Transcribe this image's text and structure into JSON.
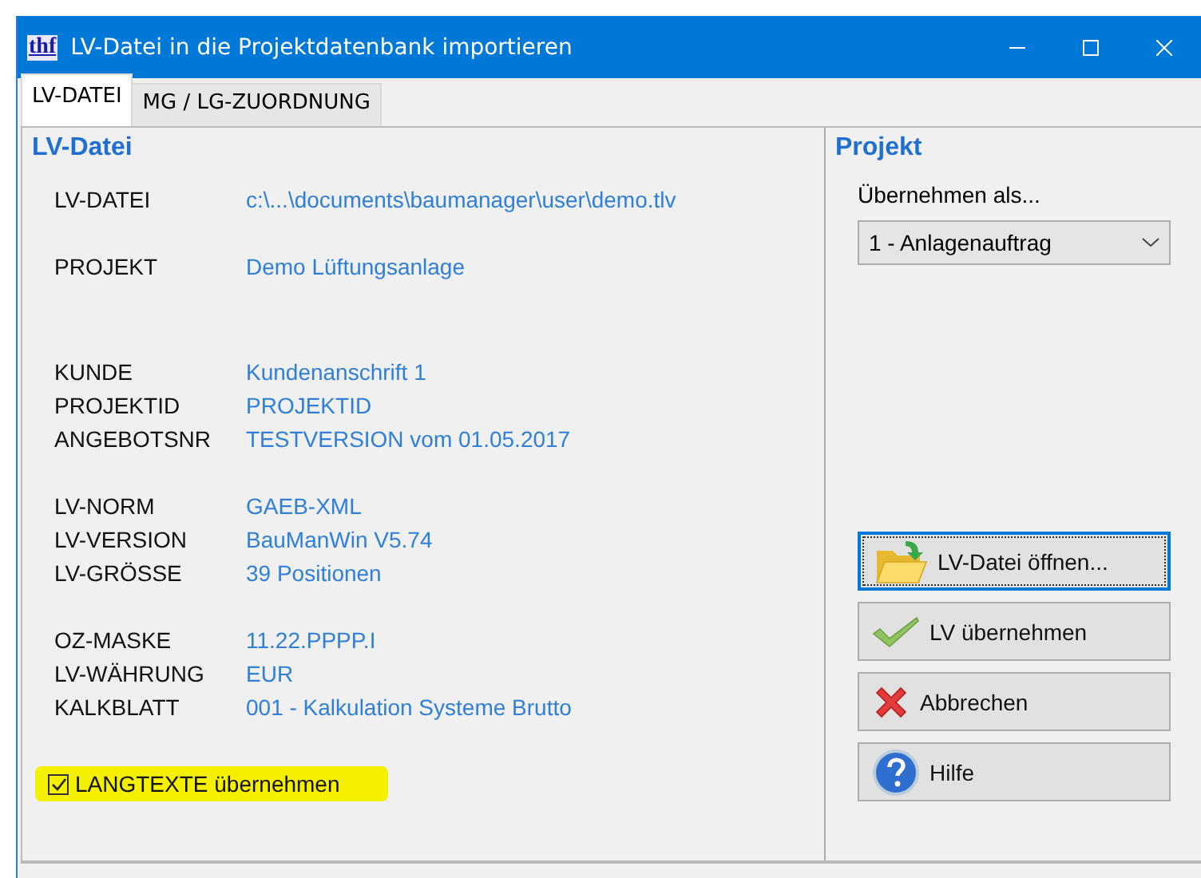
{
  "window": {
    "title": "LV-Datei in die Projektdatenbank importieren",
    "app_icon": "thf"
  },
  "tabs": [
    {
      "label": "LV-DATEI",
      "selected": true
    },
    {
      "label": "MG / LG-ZUORDNUNG",
      "selected": false
    }
  ],
  "lv_datei": {
    "heading": "LV-Datei",
    "groups": [
      [
        {
          "label": "LV-DATEI",
          "value": "c:\\...\\documents\\baumanager\\user\\demo.tlv"
        }
      ],
      [
        {
          "label": "PROJEKT",
          "value": "Demo Lüftungsanlage"
        }
      ],
      [
        {
          "label": "KUNDE",
          "value": "Kundenanschrift 1"
        },
        {
          "label": "PROJEKTID",
          "value": "PROJEKTID"
        },
        {
          "label": "ANGEBOTSNR",
          "value": "TESTVERSION vom 01.05.2017"
        }
      ],
      [
        {
          "label": "LV-NORM",
          "value": "GAEB-XML"
        },
        {
          "label": "LV-VERSION",
          "value": "BauManWin V5.74"
        },
        {
          "label": "LV-GRÖSSE",
          "value": "39 Positionen"
        }
      ],
      [
        {
          "label": "OZ-MASKE",
          "value": "11.22.PPPP.I"
        },
        {
          "label": "LV-WÄHRUNG",
          "value": "EUR"
        },
        {
          "label": "KALKBLATT",
          "value": "001 - Kalkulation Systeme Brutto"
        }
      ]
    ],
    "checkbox": {
      "label": "LANGTEXTE übernehmen",
      "checked": true,
      "highlighted": true
    }
  },
  "projekt": {
    "heading": "Projekt",
    "dropdown_label": "Übernehmen als...",
    "dropdown_value": "1 - Anlagenauftrag"
  },
  "buttons": [
    {
      "kind": "open",
      "label": "LV-Datei öffnen...",
      "focused": true
    },
    {
      "kind": "accept",
      "label": "LV übernehmen",
      "focused": false
    },
    {
      "kind": "cancel",
      "label": "Abbrechen",
      "focused": false
    },
    {
      "kind": "help",
      "label": "Hilfe",
      "focused": false
    }
  ]
}
